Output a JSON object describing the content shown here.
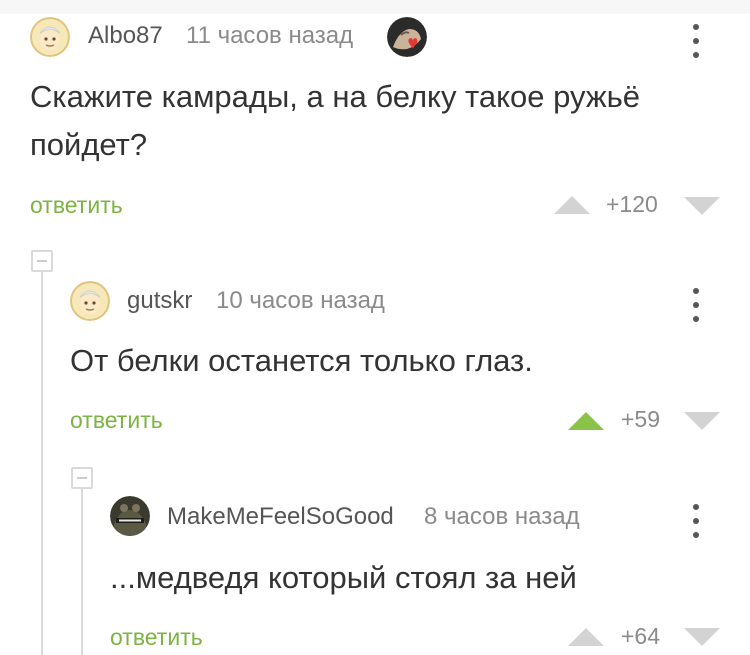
{
  "comments": [
    {
      "username": "Albo87",
      "time": "11 часов назад",
      "text_line1": "Скажите камрады, а на белку такое ружьё",
      "text_line2": "пойдет?",
      "reply": "ответить",
      "score": "+120",
      "upvoted": false
    },
    {
      "username": "gutskr",
      "time": "10 часов назад",
      "text_line1": "От белки останется только глаз.",
      "reply": "ответить",
      "score": "+59",
      "upvoted": true
    },
    {
      "username": "MakeMeFeelSoGood",
      "time": "8 часов назад",
      "text_line1": "...медведя который стоял за ней",
      "reply": "ответить",
      "score": "+64",
      "upvoted": false
    }
  ],
  "colors": {
    "reply_green": "#7cb342",
    "upvote_active": "#8bc34a",
    "vote_inactive": "#d3d3d3",
    "thread_line": "#d9d9d9"
  }
}
